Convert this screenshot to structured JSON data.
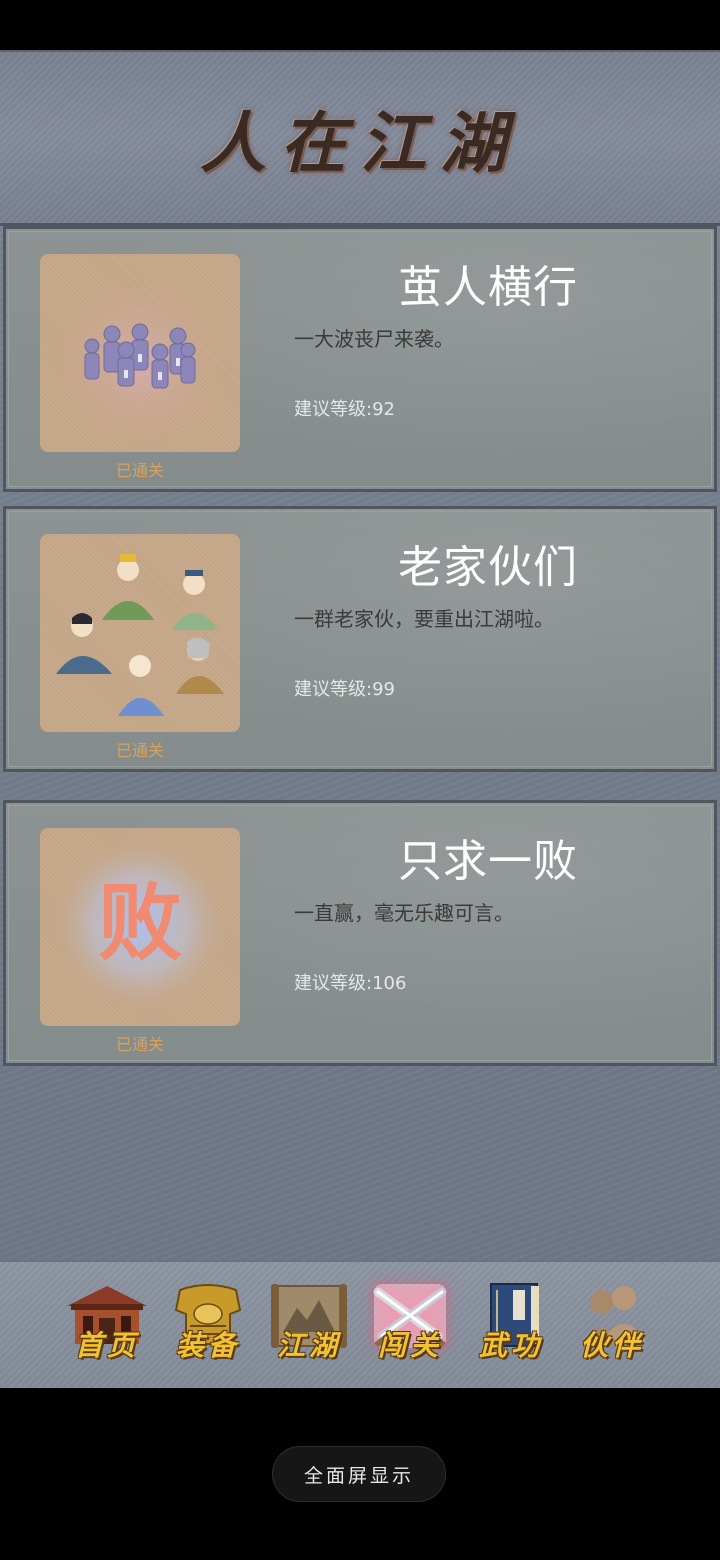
{
  "header": {
    "title": "人在江湖"
  },
  "levels": [
    {
      "title": "茧人横行",
      "description": "一大波丧尸来袭。",
      "level": "建议等级:92",
      "status": "已通关",
      "thumb_icon": "zombies-icon"
    },
    {
      "title": "老家伙们",
      "description": "一群老家伙，要重出江湖啦。",
      "level": "建议等级:99",
      "status": "已通关",
      "thumb_icon": "elders-icon"
    },
    {
      "title": "只求一败",
      "description": "一直赢，毫无乐趣可言。",
      "level": "建议等级:106",
      "status": "已通关",
      "thumb_icon": "defeat-glyph-icon",
      "thumb_glyph": "败"
    }
  ],
  "nav": [
    {
      "label": "首页",
      "icon": "house-icon"
    },
    {
      "label": "装备",
      "icon": "armor-icon"
    },
    {
      "label": "江湖",
      "icon": "scroll-map-icon"
    },
    {
      "label": "闯关",
      "icon": "crossed-swords-icon",
      "active": true
    },
    {
      "label": "武功",
      "icon": "book-icon"
    },
    {
      "label": "伙伴",
      "icon": "companions-icon"
    }
  ],
  "fullscreen_label": "全面屏显示",
  "colors": {
    "header_bg": "#7b8394",
    "card_bg": "#8a9190",
    "status_text": "#d9a25b",
    "nav_label": "#f2c230",
    "active_glow": "#ff4d7a"
  }
}
